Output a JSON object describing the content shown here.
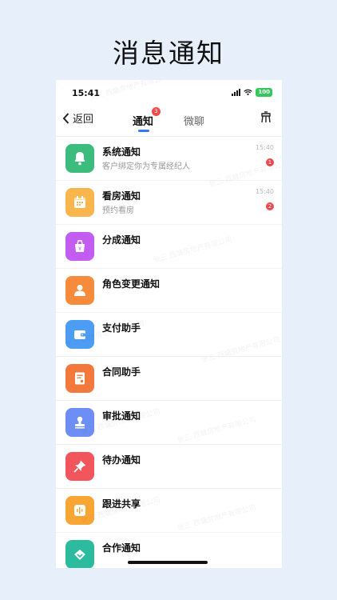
{
  "promo": {
    "title": "消息通知"
  },
  "status_bar": {
    "time": "15:41",
    "battery": "100"
  },
  "nav": {
    "back_label": "返回",
    "tab_notify": "通知",
    "tab_notify_badge": "3",
    "tab_chat": "微聊"
  },
  "watermark": "张三 西塘房地产有限公司",
  "items": [
    {
      "title": "系统通知",
      "subtitle": "客户绑定你为专属经纪人",
      "time": "15:40",
      "badge": "1",
      "color": "#3dbd7d",
      "icon": "bell-icon"
    },
    {
      "title": "看房通知",
      "subtitle": "预约看房",
      "time": "15:40",
      "badge": "2",
      "color": "#f8b64c",
      "icon": "calendar-icon"
    },
    {
      "title": "分成通知",
      "color": "#c35cf0",
      "icon": "wallet-bag-icon"
    },
    {
      "title": "角色变更通知",
      "color": "#f58b3b",
      "icon": "user-switch-icon"
    },
    {
      "title": "支付助手",
      "color": "#4d9df5",
      "icon": "wallet-icon"
    },
    {
      "title": "合同助手",
      "color": "#f3783c",
      "icon": "contract-icon"
    },
    {
      "title": "审批通知",
      "color": "#6d8ff5",
      "icon": "stamp-icon"
    },
    {
      "title": "待办通知",
      "color": "#f2565c",
      "icon": "pin-icon"
    },
    {
      "title": "跟进共享",
      "color": "#f8a534",
      "icon": "audio-icon"
    },
    {
      "title": "合作通知",
      "color": "#2dbb9f",
      "icon": "handshake-icon"
    }
  ]
}
